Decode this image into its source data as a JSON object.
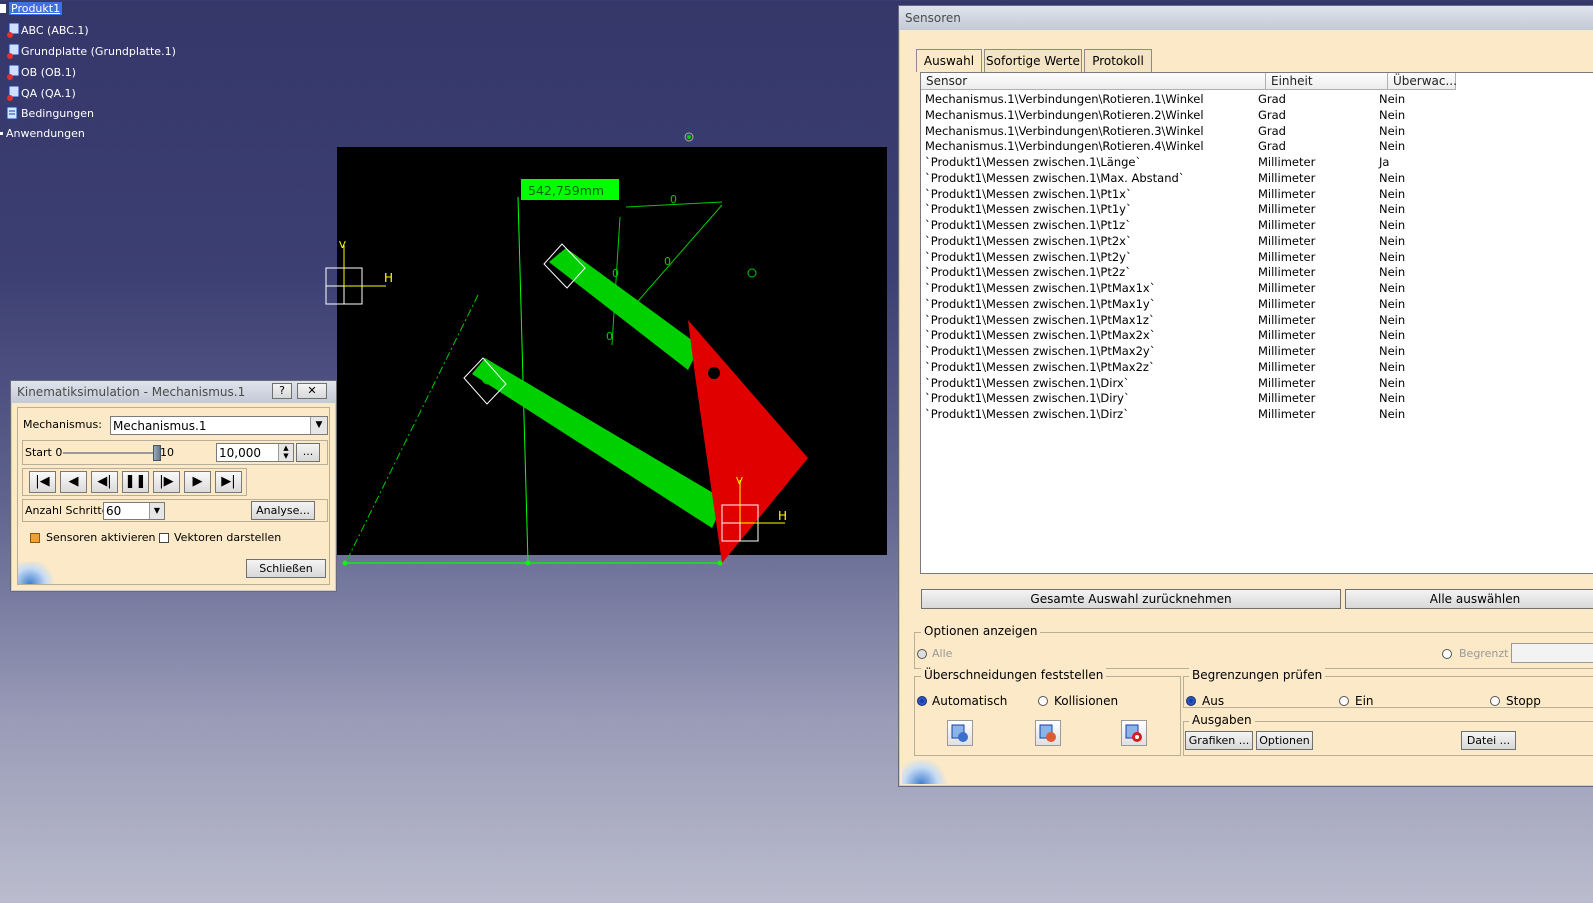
{
  "tree": {
    "items": [
      {
        "label": "Produkt1",
        "selected": true,
        "icon": "product-icon"
      },
      {
        "label": "ABC (ABC.1)",
        "icon": "part-icon"
      },
      {
        "label": "Grundplatte (Grundplatte.1)",
        "icon": "part-icon"
      },
      {
        "label": "OB (OB.1)",
        "icon": "part-icon"
      },
      {
        "label": "QA (QA.1)",
        "icon": "part-icon"
      },
      {
        "label": "Bedingungen",
        "icon": "constraints-icon"
      },
      {
        "label": "Anwendungen",
        "icon": "applications-icon"
      }
    ]
  },
  "viewport": {
    "measure_label": "542,759mm",
    "axis_v": "V",
    "axis_h": "H",
    "colors": {
      "link": "#00d000",
      "triangle": "#e00000",
      "sketch": "#00ff00",
      "axis": "#ffff00",
      "bg": "#000000"
    }
  },
  "kinematics": {
    "title": "Kinematiksimulation - Mechanismus.1",
    "help": "?",
    "close": "✕",
    "mechanism_label": "Mechanismus:",
    "mechanism_value": "Mechanismus.1",
    "start_label": "Start 0",
    "end_label": "10",
    "slider_fraction": 1.0,
    "value": "10,000",
    "more": "...",
    "controls": [
      "|◀",
      "◀",
      "◀|",
      "❚❚",
      "|▶",
      "▶",
      "▶|"
    ],
    "steps_label": "Anzahl Schritte:",
    "steps_value": "60",
    "analyse": "Analyse...",
    "sensors_active": "Sensoren aktivieren",
    "vectors": "Vektoren darstellen",
    "close_button": "Schließen"
  },
  "sensors": {
    "title": "Sensoren",
    "tabs": [
      "Auswahl",
      "Sofortige Werte",
      "Protokoll"
    ],
    "columns": [
      "Sensor",
      "Einheit",
      "Überwac..."
    ],
    "rows": [
      [
        "Mechanismus.1\\Verbindungen\\Rotieren.1\\Winkel",
        "Grad",
        "Nein"
      ],
      [
        "Mechanismus.1\\Verbindungen\\Rotieren.2\\Winkel",
        "Grad",
        "Nein"
      ],
      [
        "Mechanismus.1\\Verbindungen\\Rotieren.3\\Winkel",
        "Grad",
        "Nein"
      ],
      [
        "Mechanismus.1\\Verbindungen\\Rotieren.4\\Winkel",
        "Grad",
        "Nein"
      ],
      [
        "`Produkt1\\Messen zwischen.1\\Länge`",
        "Millimeter",
        "Ja"
      ],
      [
        "`Produkt1\\Messen zwischen.1\\Max. Abstand`",
        "Millimeter",
        "Nein"
      ],
      [
        "`Produkt1\\Messen zwischen.1\\Pt1x`",
        "Millimeter",
        "Nein"
      ],
      [
        "`Produkt1\\Messen zwischen.1\\Pt1y`",
        "Millimeter",
        "Nein"
      ],
      [
        "`Produkt1\\Messen zwischen.1\\Pt1z`",
        "Millimeter",
        "Nein"
      ],
      [
        "`Produkt1\\Messen zwischen.1\\Pt2x`",
        "Millimeter",
        "Nein"
      ],
      [
        "`Produkt1\\Messen zwischen.1\\Pt2y`",
        "Millimeter",
        "Nein"
      ],
      [
        "`Produkt1\\Messen zwischen.1\\Pt2z`",
        "Millimeter",
        "Nein"
      ],
      [
        "`Produkt1\\Messen zwischen.1\\PtMax1x`",
        "Millimeter",
        "Nein"
      ],
      [
        "`Produkt1\\Messen zwischen.1\\PtMax1y`",
        "Millimeter",
        "Nein"
      ],
      [
        "`Produkt1\\Messen zwischen.1\\PtMax1z`",
        "Millimeter",
        "Nein"
      ],
      [
        "`Produkt1\\Messen zwischen.1\\PtMax2x`",
        "Millimeter",
        "Nein"
      ],
      [
        "`Produkt1\\Messen zwischen.1\\PtMax2y`",
        "Millimeter",
        "Nein"
      ],
      [
        "`Produkt1\\Messen zwischen.1\\PtMax2z`",
        "Millimeter",
        "Nein"
      ],
      [
        "`Produkt1\\Messen zwischen.1\\Dirx`",
        "Millimeter",
        "Nein"
      ],
      [
        "`Produkt1\\Messen zwischen.1\\Diry`",
        "Millimeter",
        "Nein"
      ],
      [
        "`Produkt1\\Messen zwischen.1\\Dirz`",
        "Millimeter",
        "Nein"
      ]
    ],
    "deselect_all": "Gesamte Auswahl zurücknehmen",
    "select_all": "Alle auswählen",
    "options_group": "Optionen anzeigen",
    "opt_all": "Alle",
    "opt_limited": "Begrenzt",
    "intersections_group": "Überschneidungen feststellen",
    "int_auto": "Automatisch",
    "int_collisions": "Kollisionen",
    "limits_group": "Begrenzungen prüfen",
    "lim_off": "Aus",
    "lim_on": "Ein",
    "lim_stop": "Stopp",
    "outputs_group": "Ausgaben",
    "graphs": "Grafiken ...",
    "options": "Optionen",
    "file": "Datei ..."
  }
}
